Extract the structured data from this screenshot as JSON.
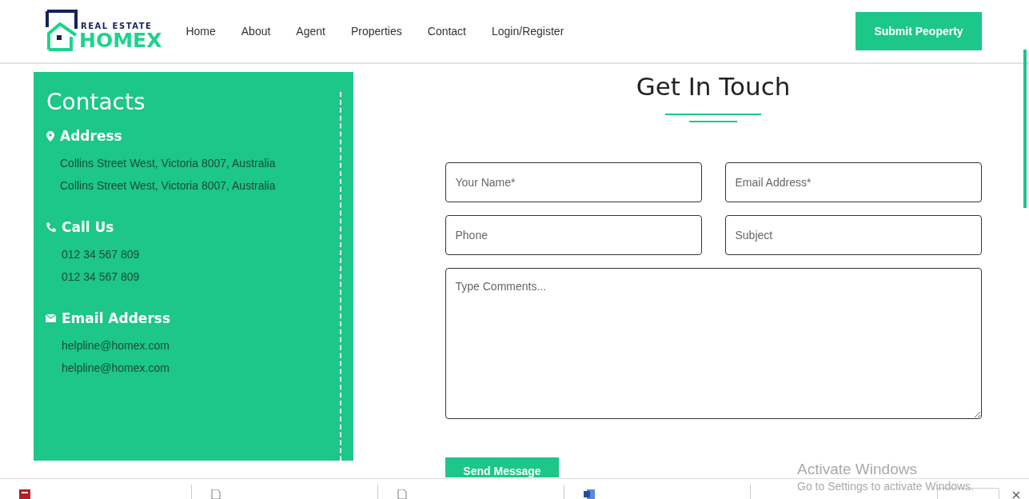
{
  "logo": {
    "tagline": "REAL ESTATE",
    "name": "HOMEX"
  },
  "nav": [
    "Home",
    "About",
    "Agent",
    "Properties",
    "Contact",
    "Login/Register"
  ],
  "submit_button": "Submit Peoperty",
  "contacts": {
    "title": "Contacts",
    "sections": [
      {
        "kind": "address",
        "heading": "Address",
        "lines": [
          "Collins Street West, Victoria 8007, Australia",
          "Collins Street West, Victoria 8007, Australia"
        ]
      },
      {
        "kind": "phone",
        "heading": "Call Us",
        "lines": [
          "012 34 567 809",
          "012 34 567 809"
        ]
      },
      {
        "kind": "email",
        "heading": "Email Adderss",
        "lines": [
          "helpline@homex.com",
          "helpline@homex.com"
        ]
      }
    ]
  },
  "form": {
    "title": "Get In Touch",
    "fields": [
      {
        "kind": "input",
        "placeholder": "Your Name*"
      },
      {
        "kind": "input",
        "placeholder": "Email Address*"
      },
      {
        "kind": "input",
        "placeholder": "Phone"
      },
      {
        "kind": "input",
        "placeholder": "Subject"
      },
      {
        "kind": "textarea",
        "placeholder": "Type Comments..."
      }
    ],
    "button": "Send Message"
  },
  "downloads": [
    {
      "kind": "pdf"
    },
    {
      "kind": "file"
    },
    {
      "kind": "file"
    },
    {
      "kind": "word"
    }
  ],
  "activation_notice": {
    "title": "Activate Windows",
    "text": "Go to Settings to activate Windows."
  }
}
